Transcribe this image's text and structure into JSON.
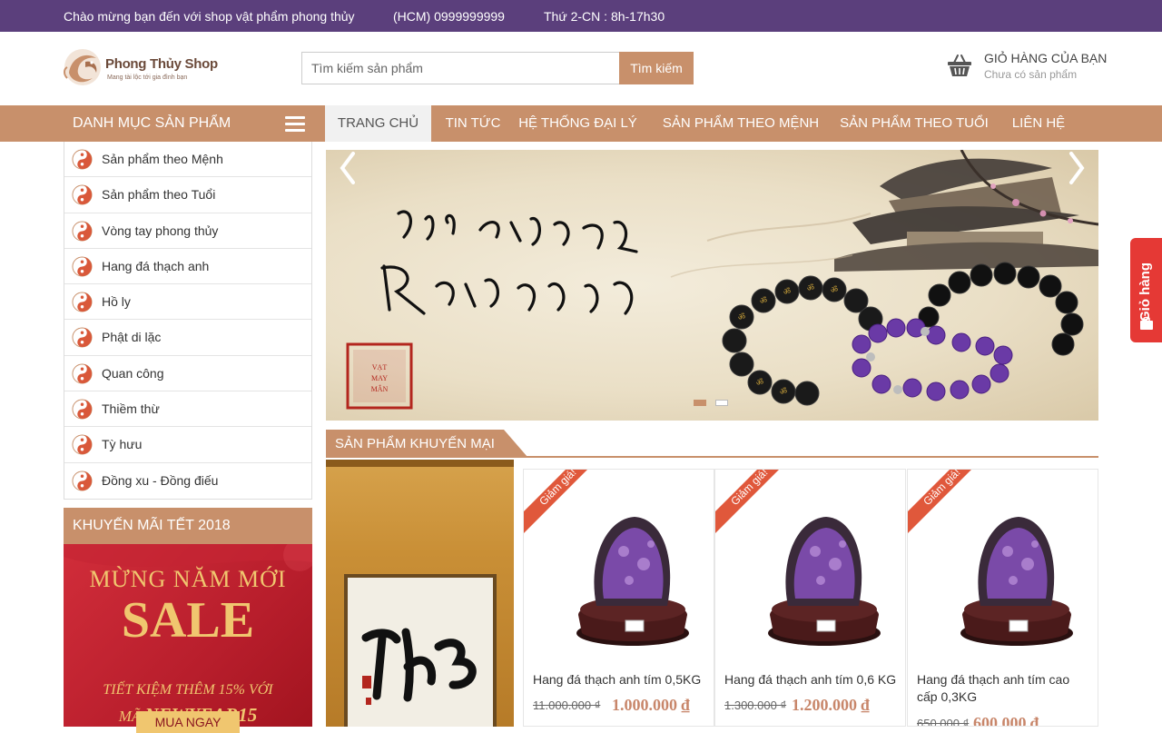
{
  "topbar": {
    "welcome": "Chào mừng bạn đến với shop vật phẩm phong thủy",
    "phone": "(HCM) 0999999999",
    "hours": "Thứ 2-CN : 8h-17h30"
  },
  "logo": {
    "name": "Phong Thủy Shop",
    "slogan": "Mang tài lộc tới gia đình bạn"
  },
  "search": {
    "placeholder": "Tìm kiếm sản phẩm",
    "button": "Tìm kiếm"
  },
  "cart": {
    "title": "GIỎ HÀNG CỦA BẠN",
    "status": "Chưa có sản phẩm",
    "icon": "basket-icon"
  },
  "nav": {
    "category_title": "DANH MỤC SẢN PHẨM",
    "items": [
      "TRANG CHỦ",
      "TIN TỨC",
      "HỆ THỐNG ĐẠI LÝ",
      "SẢN PHẨM THEO MỆNH",
      "SẢN PHẨM THEO TUỔI",
      "LIÊN HỆ"
    ],
    "active": "TRANG CHỦ"
  },
  "categories": [
    "Sản phẩm theo Mệnh",
    "Sản phẩm theo Tuổi",
    "Vòng tay phong thủy",
    "Hang đá thạch anh",
    "Hồ ly",
    "Phật di lặc",
    "Quan công",
    "Thiềm thừ",
    "Tỳ hưu",
    "Đồng xu - Đồng điếu"
  ],
  "promo_box": {
    "title": "KHUYẾN MÃI TẾT 2018",
    "banner": {
      "line1": "MỪNG NĂM MỚI",
      "line2": "SALE",
      "line3": "TIẾT KIỆM THÊM 15% VỚI",
      "line4_prefix": "MÃ",
      "line4_code": "NEWYEAR15",
      "button": "MUA NGAY"
    }
  },
  "slider": {
    "slides_total": 2,
    "active_slide": 1,
    "calligraphy_stamp": "VẠT MAY MẮN",
    "colors": {
      "accent": "#c8906b",
      "header": "#5b3f7c"
    }
  },
  "promo_section": {
    "title": "SẢN PHẨM KHUYẾN MẠI",
    "ribbon": "Giảm giá!",
    "products": [
      {
        "name": "Hang đá thạch anh tím 0,5KG",
        "old_price": "11.000.000 ₫",
        "price": "1.000.000 ₫"
      },
      {
        "name": "Hang đá thạch anh tím 0,6 KG",
        "old_price": "1.300.000 ₫",
        "price": "1.200.000 ₫"
      },
      {
        "name": "Hang đá thạch anh tím cao cấp 0,3KG",
        "old_price": "650.000 ₫",
        "price": "600.000 ₫"
      }
    ]
  },
  "side_cart": {
    "label": "Giỏ hàng"
  }
}
